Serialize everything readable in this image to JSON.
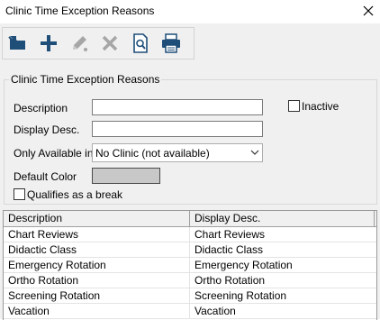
{
  "window": {
    "title": "Clinic Time Exception Reasons",
    "close_icon": "close-icon"
  },
  "toolbar": {
    "buttons": [
      {
        "name": "import-button",
        "icon": "import-icon",
        "enabled": true
      },
      {
        "name": "add-button",
        "icon": "plus-icon",
        "enabled": true
      },
      {
        "name": "edit-button",
        "icon": "pencil-icon",
        "enabled": false
      },
      {
        "name": "delete-button",
        "icon": "x-delete-icon",
        "enabled": false
      },
      {
        "name": "preview-button",
        "icon": "print-preview-icon",
        "enabled": true
      },
      {
        "name": "print-button",
        "icon": "printer-icon",
        "enabled": true
      }
    ]
  },
  "details": {
    "group_title": "Clinic Time Exception Reasons",
    "description_label": "Description",
    "description_value": "",
    "display_desc_label": "Display Desc.",
    "display_desc_value": "",
    "inactive_label": "Inactive",
    "inactive_checked": false,
    "only_available_label": "Only Available in",
    "only_available_value": "No Clinic (not available)",
    "default_color_label": "Default Color",
    "default_color": "#c8c8c8",
    "qualifies_label": "Qualifies as a break",
    "qualifies_checked": false
  },
  "grid": {
    "columns": [
      "Description",
      "Display Desc."
    ],
    "rows": [
      {
        "description": "Chart Reviews",
        "display": "Chart Reviews"
      },
      {
        "description": "Didactic Class",
        "display": "Didactic Class"
      },
      {
        "description": "Emergency Rotation",
        "display": "Emergency Rotation"
      },
      {
        "description": "Ortho Rotation",
        "display": "Ortho Rotation"
      },
      {
        "description": "Screening Rotation",
        "display": "Screening Rotation"
      },
      {
        "description": "Vacation",
        "display": "Vacation"
      }
    ]
  },
  "colors": {
    "toolbar_icon": "#1f4e79",
    "disabled_icon": "#a6a6a6",
    "panel_bg": "#f0f0f0"
  }
}
